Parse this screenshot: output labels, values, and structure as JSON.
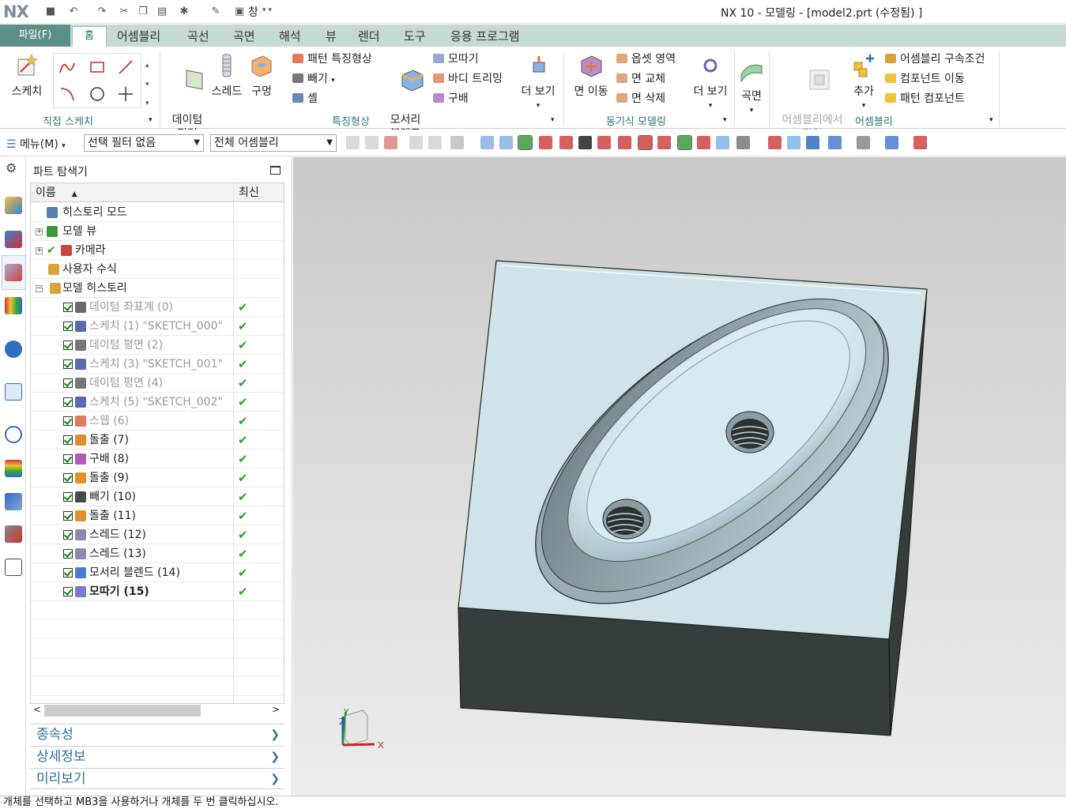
{
  "app": {
    "logo": "NX",
    "title": "NX 10 - 모델링 - [model2.prt (수정됨) ]",
    "window_menu": "창"
  },
  "tabs": [
    {
      "label": "파일(F)"
    },
    {
      "label": "홈"
    },
    {
      "label": "어셈블리"
    },
    {
      "label": "곡선"
    },
    {
      "label": "곡면"
    },
    {
      "label": "해석"
    },
    {
      "label": "뷰"
    },
    {
      "label": "렌더"
    },
    {
      "label": "도구"
    },
    {
      "label": "응용 프로그램"
    }
  ],
  "ribbon": {
    "sketch": {
      "label": "스케치"
    },
    "direct_sketch_group": "직접 스케치",
    "datum_plane": "데이텀\n평면",
    "thread": "스레드",
    "hole": "구멍",
    "pattern_feature": "패턴 특징형상",
    "subtract": "빼기",
    "shell": "셸",
    "edge_blend": "모서리\n블렌드",
    "chamfer": "모따기",
    "trim_body": "바디 트리밍",
    "draft": "구배",
    "more1": "더 보기",
    "feature_group": "특징형상",
    "move_face": "면 이동",
    "offset_region": "옵셋 영역",
    "replace_face": "면 교체",
    "delete_face": "면 삭제",
    "more2": "더 보기",
    "sync_group": "동기식 모델링",
    "surface": "곡면",
    "work_in_assembly": "어셈블리에서\n작업",
    "add": "추가",
    "assembly_constraints": "어셈블리 구속조건",
    "move_component": "컴포넌트 이동",
    "pattern_component": "패턴 컴포넌트",
    "assembly_group": "어셈블리"
  },
  "cmdbar": {
    "menu": "메뉴(M)",
    "selection_filter": "선택 필터 없음",
    "assembly_scope": "전체 어셈블리"
  },
  "navigator": {
    "title": "파트 탐색기",
    "col_name": "이름",
    "col_latest": "최신",
    "rows": [
      {
        "label": "히스토리 모드",
        "dim": false
      },
      {
        "label": "모델 뷰",
        "dim": false
      },
      {
        "label": "카메라",
        "dim": false
      },
      {
        "label": "사용자 수식",
        "dim": false
      },
      {
        "label": "모델 히스토리",
        "dim": false
      },
      {
        "label": "데이텀 좌표계 (0)",
        "dim": true
      },
      {
        "label": "스케치 (1) \"SKETCH_000\"",
        "dim": true
      },
      {
        "label": "데이텀 평면 (2)",
        "dim": true
      },
      {
        "label": "스케치 (3) \"SKETCH_001\"",
        "dim": true
      },
      {
        "label": "데이텀 평면 (4)",
        "dim": true
      },
      {
        "label": "스케치 (5) \"SKETCH_002\"",
        "dim": true
      },
      {
        "label": "스웹 (6)",
        "dim": true
      },
      {
        "label": "돌출 (7)",
        "dim": false
      },
      {
        "label": "구배 (8)",
        "dim": false
      },
      {
        "label": "돌출 (9)",
        "dim": false
      },
      {
        "label": "빼기 (10)",
        "dim": false
      },
      {
        "label": "돌출 (11)",
        "dim": false
      },
      {
        "label": "스레드 (12)",
        "dim": false
      },
      {
        "label": "스레드 (13)",
        "dim": false
      },
      {
        "label": "모서리 블렌드 (14)",
        "dim": false
      },
      {
        "label": "모따기 (15)",
        "dim": false
      }
    ],
    "panels": {
      "dependencies": "종속성",
      "details": "상세정보",
      "preview": "미리보기"
    }
  },
  "triad": {
    "x": "X",
    "y": "Y",
    "z": "Z"
  },
  "status": "개체를 선택하고 MB3을 사용하거나 개체를 두 번 클릭하십시오.",
  "colors": {
    "ribbon_tab_bg": "#c5d9d5",
    "file_tab": "#5c8f87",
    "accent_text": "#2a7a72",
    "check_green": "#2da02d",
    "model_top": "#cfe3e8",
    "model_side": "#2f3638"
  }
}
